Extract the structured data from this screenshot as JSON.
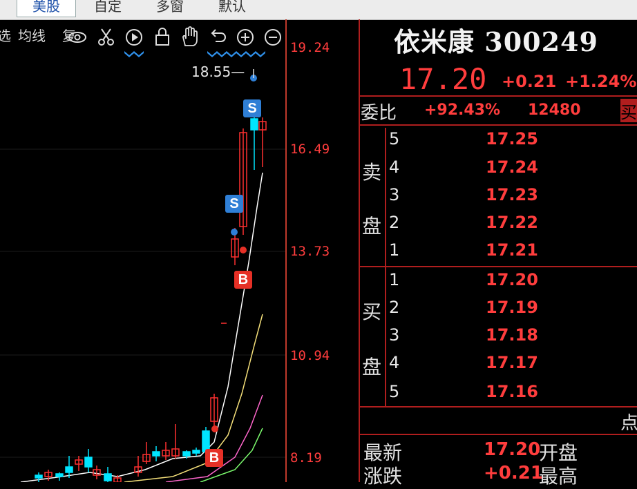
{
  "menu": {
    "items": [
      "美股",
      "自定",
      "多窗",
      "默认"
    ]
  },
  "toolbar": {
    "text_items": [
      "选",
      "均线",
      "复"
    ],
    "icons": [
      "eye-icon",
      "scissors-icon",
      "play-icon",
      "lock-icon",
      "hand-icon",
      "undo-icon",
      "zoom-in-icon",
      "zoom-out-icon"
    ]
  },
  "chart": {
    "price_axis": [
      "19.24",
      "16.49",
      "13.73",
      "10.94",
      "8.19"
    ],
    "high_annotation": "18.55",
    "markers": [
      "S",
      "S",
      "B",
      "B"
    ],
    "colors": {
      "up": "#ff3030",
      "down": "#00e5ff",
      "ma_white": "#ffffff",
      "ma_yellow": "#f5e07a",
      "ma_green": "#7cfc6e",
      "ma_pink": "#ff66cc",
      "buy_marker": "#e63026",
      "sell_marker": "#2f7fd6"
    }
  },
  "quote": {
    "name": "依米康",
    "code": "300249",
    "last": "17.20",
    "change": "+0.21",
    "change_pct": "+1.24%",
    "weibi_label": "委比",
    "weibi_pct": "+92.43%",
    "weicha": "12480",
    "tag": "买",
    "sell_label_1": "卖",
    "sell_label_2": "盘",
    "buy_label_1": "买",
    "buy_label_2": "盘",
    "sell": [
      {
        "level": "5",
        "price": "17.25"
      },
      {
        "level": "4",
        "price": "17.24"
      },
      {
        "level": "3",
        "price": "17.23"
      },
      {
        "level": "2",
        "price": "17.22"
      },
      {
        "level": "1",
        "price": "17.21"
      }
    ],
    "buy": [
      {
        "level": "1",
        "price": "17.20"
      },
      {
        "level": "2",
        "price": "17.19"
      },
      {
        "level": "3",
        "price": "17.18"
      },
      {
        "level": "4",
        "price": "17.17"
      },
      {
        "level": "5",
        "price": "17.16"
      }
    ],
    "dian": "点",
    "stats": {
      "latest_label": "最新",
      "latest_value": "17.20",
      "open_label": "开盘",
      "change_label": "涨跌",
      "change_value": "+0.21",
      "high_label": "最高"
    }
  }
}
